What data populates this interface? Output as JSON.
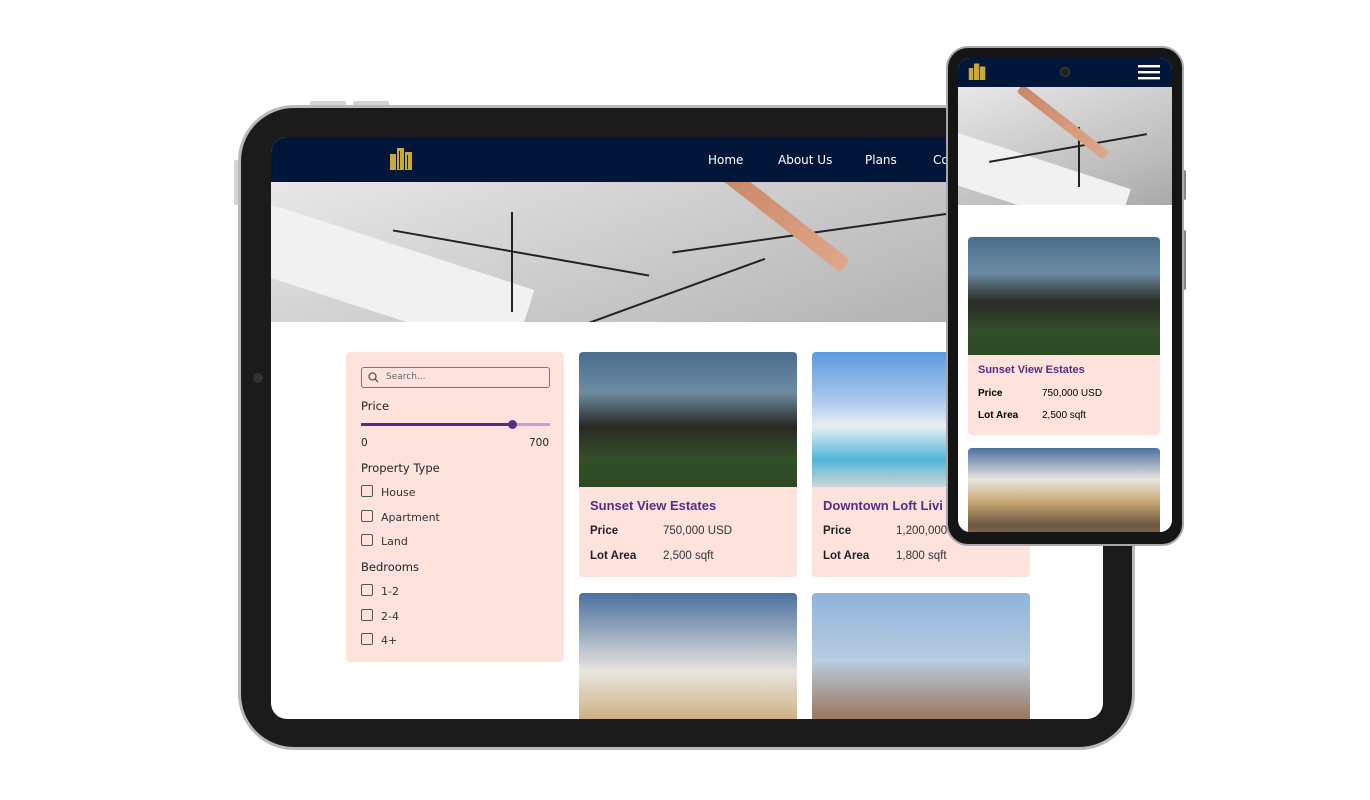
{
  "nav": {
    "links": [
      "Home",
      "About Us",
      "Plans",
      "Co"
    ]
  },
  "filter": {
    "search_placeholder": "Search...",
    "price_label": "Price",
    "price_min": "0",
    "price_max": "700",
    "price_value_fraction": 0.8,
    "property_type_label": "Property Type",
    "property_types": [
      "House",
      "Apartment",
      "Land"
    ],
    "bedrooms_label": "Bedrooms",
    "bedrooms": [
      "1-2",
      "2-4",
      "4+"
    ]
  },
  "listings": [
    {
      "title": "Sunset View Estates",
      "price_label": "Price",
      "price": "750,000 USD",
      "area_label": "Lot Area",
      "area": "2,500 sqft"
    },
    {
      "title": "Downtown Loft Livi",
      "price_label": "Price",
      "price": "1,200,000",
      "area_label": "Lot Area",
      "area": "1,800 sqft"
    }
  ],
  "colors": {
    "nav": "#02163a",
    "accent": "#5b2a82",
    "card_bg": "#fde3dc",
    "logo": "#c9a93a"
  }
}
